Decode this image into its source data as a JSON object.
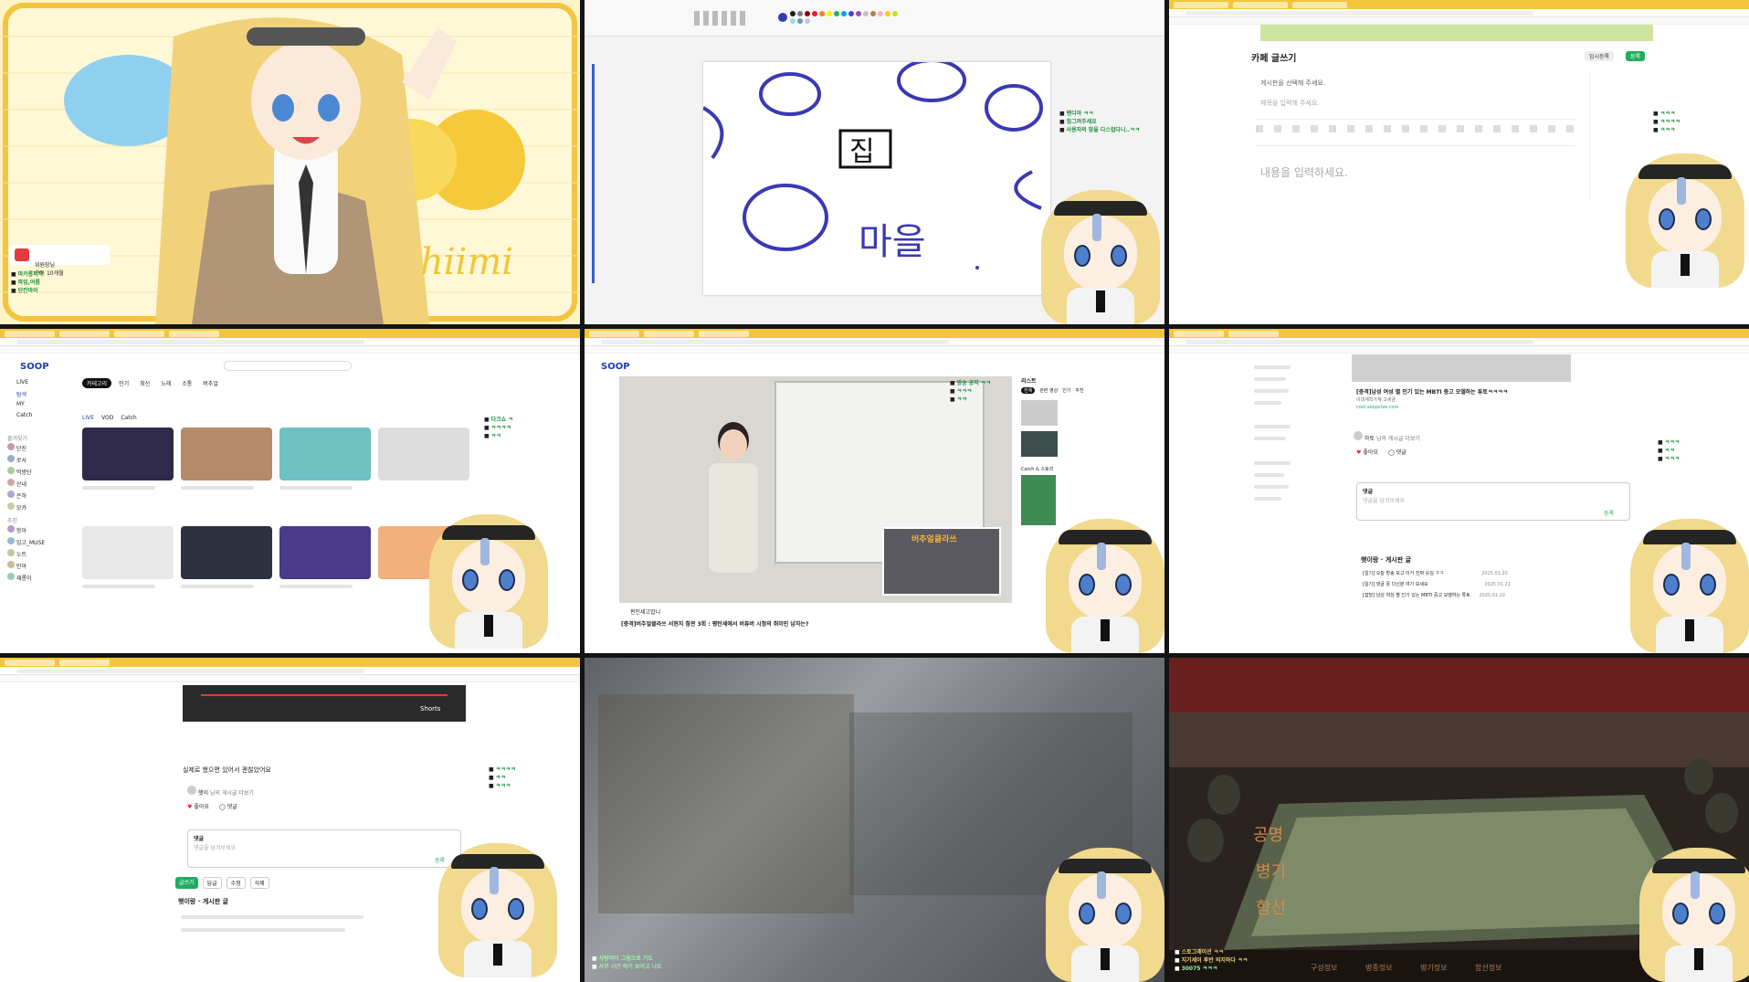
{
  "tile1": {
    "chat": [
      "마카롱피자",
      "파임,여름",
      "단칸마이"
    ],
    "badge": "위원장님\n구독 10개월",
    "signature": "hiimi"
  },
  "tile2": {
    "canvas_chars": [
      "집",
      "마을"
    ],
    "chat": [
      "밴디아 ㅋㅋ",
      "집그려주세요",
      "사용자의 맘을 다스럽다니..ㅋㅋ"
    ],
    "palette": [
      "#1c1c1c",
      "#7f7f7f",
      "#880015",
      "#ed1c24",
      "#ff7f27",
      "#fff200",
      "#22b14c",
      "#00a2e8",
      "#3f48cc",
      "#a349a4",
      "#ffffff",
      "#c3c3c3",
      "#b97a57",
      "#ffaec9",
      "#ffc90e",
      "#efe4b0",
      "#b5e61d",
      "#99d9ea",
      "#7092be",
      "#c8bfe7"
    ],
    "selected_color": "#3a39b4"
  },
  "tile3": {
    "title": "카페 글쓰기",
    "save": "임시등록",
    "submit": "등록",
    "board_select": "게시판을 선택해 주세요.",
    "title_placeholder": "제목을 입력해 주세요.",
    "body_placeholder": "내용을 입력하세요.",
    "chat": [
      "ㅋㅋㅋ",
      "ㅋㅋㅋㅋ",
      "ㅋㅋㅋ"
    ]
  },
  "tile4": {
    "logo": "SOOP",
    "nav": [
      "LIVE",
      "탐색",
      "MY",
      "Catch"
    ],
    "filters": [
      "카테고리",
      "인기",
      "최신",
      "노래",
      "소통",
      "버추얼"
    ],
    "subtabs": [
      "LIVE",
      "VOD",
      "Catch"
    ],
    "section": "즐겨찾기",
    "recommend": "추천",
    "more": "더보기",
    "sidebar_users": [
      "단진",
      "로사",
      "먹방단",
      "산내",
      "은하",
      "모카"
    ],
    "rec_users": [
      "항아",
      "임고_MUSE",
      "누트",
      "민아",
      "재롱이"
    ],
    "chat": [
      "다크쇼 ㅋ",
      "ㅋㅋㅋㅋ",
      "ㅋㅋ"
    ]
  },
  "tile5": {
    "logo": "SOOP",
    "overlay_title": "버추얼클라쓰",
    "video_title": "[충격]버추얼클라쓰 서현지 참관 3회 : 평탄세에서 버튜버 시청의 취미인 남자는?",
    "channel": "펀인세고맙니",
    "side_title": "리스트",
    "side_tabs": [
      "전체",
      "관련 영상",
      "인기",
      "추천"
    ],
    "catch_title": "Catch & 스토리",
    "chat": [
      "방송 공지 ㅋㅋ",
      "ㅋㅋㅋ",
      "ㅋㅋ"
    ]
  },
  "tile6": {
    "link_title": "[충격]남성 여성 별 인기 있는 MBTI 중고 모델하는 튜토ㅋㅋㅋㅋ",
    "link_sub": "이대계학가계 고세금",
    "link_site": "cool.soopvive.com",
    "comment_user": "하토",
    "comment_text": "님의 게시글 더보기",
    "like": "좋아요",
    "comment": "댓글",
    "reply_label": "댓글",
    "reply_placeholder": "댓글을 남겨보세요",
    "reply_btn": "등록",
    "board_title": "햇이랑 · 게시판 글",
    "board_rows": [
      "[일기] 오늘 방송 보고 이거 진짜 웃김 ㅋㅋ",
      "[일기] 댓글 못 다신분 여기 보세요",
      "[잡담] 남성 여성 별 인기 있는 MBTI 중고 모델하는 튜토"
    ],
    "board_dates": [
      "2025.01.20",
      "2025.01.21",
      "2025.01.22"
    ],
    "chat": [
      "ㅋㅋㅋ",
      "ㅋㅋ",
      "ㅋㅋㅋ"
    ]
  },
  "tile7": {
    "shorts": "Shorts",
    "caption": "실제로 했으면 있어서 괜찮았어요",
    "comment_user": "햇이",
    "comment_text": "님의 게시글 더보기",
    "like": "좋아요",
    "comment": "댓글",
    "reply_label": "댓글",
    "reply_placeholder": "댓글을 남겨보세요",
    "register": "등록",
    "board_title": "햇이랑 · 게시판 글",
    "buttons": [
      "글쓰기",
      "답글",
      "수정",
      "삭제"
    ],
    "chat": [
      "ㅋㅋㅋㅋ",
      "ㅋㅋ",
      "ㅋㅋㅋ"
    ]
  },
  "tile8": {
    "chat": [
      "사탕이더 그림으로 기도",
      "사무 시간 하기 보이고 나도"
    ]
  },
  "tile9": {
    "map_chars": [
      "공명",
      "병기",
      "함선"
    ],
    "bottom_hud": [
      "구성정보",
      "병종정보",
      "병기정보",
      "함선정보"
    ],
    "chat": [
      "스토그래이션 ㅋㅋ",
      "지기세이 후반 의지하다 ㅋㅋ",
      "30075 ㅋㅋㅋ"
    ]
  }
}
